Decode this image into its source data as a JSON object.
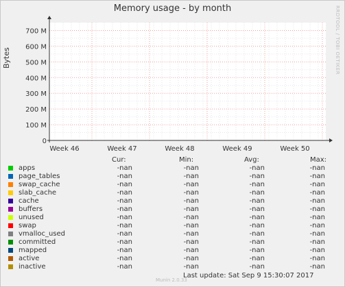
{
  "watermark": "RRDTOOL / TOBI OETIKER",
  "chart_data": {
    "type": "line",
    "title": "Memory usage - by month",
    "ylabel": "Bytes",
    "x_ticks": [
      "Week 46",
      "Week 47",
      "Week 48",
      "Week 49",
      "Week 50"
    ],
    "y_ticks": [
      "0",
      "100 M",
      "200 M",
      "300 M",
      "400 M",
      "500 M",
      "600 M",
      "700 M"
    ],
    "ylim": [
      0,
      750000000
    ],
    "grid": true,
    "series": [
      {
        "name": "apps",
        "color": "#00cc00",
        "cur": "-nan",
        "min": "-nan",
        "avg": "-nan",
        "max": "-nan"
      },
      {
        "name": "page_tables",
        "color": "#0066b3",
        "cur": "-nan",
        "min": "-nan",
        "avg": "-nan",
        "max": "-nan"
      },
      {
        "name": "swap_cache",
        "color": "#ff8000",
        "cur": "-nan",
        "min": "-nan",
        "avg": "-nan",
        "max": "-nan"
      },
      {
        "name": "slab_cache",
        "color": "#ffcc00",
        "cur": "-nan",
        "min": "-nan",
        "avg": "-nan",
        "max": "-nan"
      },
      {
        "name": "cache",
        "color": "#330099",
        "cur": "-nan",
        "min": "-nan",
        "avg": "-nan",
        "max": "-nan"
      },
      {
        "name": "buffers",
        "color": "#990099",
        "cur": "-nan",
        "min": "-nan",
        "avg": "-nan",
        "max": "-nan"
      },
      {
        "name": "unused",
        "color": "#ccff00",
        "cur": "-nan",
        "min": "-nan",
        "avg": "-nan",
        "max": "-nan"
      },
      {
        "name": "swap",
        "color": "#ff0000",
        "cur": "-nan",
        "min": "-nan",
        "avg": "-nan",
        "max": "-nan"
      },
      {
        "name": "vmalloc_used",
        "color": "#808080",
        "cur": "-nan",
        "min": "-nan",
        "avg": "-nan",
        "max": "-nan"
      },
      {
        "name": "committed",
        "color": "#008f00",
        "cur": "-nan",
        "min": "-nan",
        "avg": "-nan",
        "max": "-nan"
      },
      {
        "name": "mapped",
        "color": "#00487d",
        "cur": "-nan",
        "min": "-nan",
        "avg": "-nan",
        "max": "-nan"
      },
      {
        "name": "active",
        "color": "#b35a00",
        "cur": "-nan",
        "min": "-nan",
        "avg": "-nan",
        "max": "-nan"
      },
      {
        "name": "inactive",
        "color": "#b38f00",
        "cur": "-nan",
        "min": "-nan",
        "avg": "-nan",
        "max": "-nan"
      }
    ]
  },
  "legend_headers": {
    "cur": "Cur:",
    "min": "Min:",
    "avg": "Avg:",
    "max": "Max:"
  },
  "footer": {
    "last_update": "Last update: Sat Sep  9 15:30:07 2017",
    "munin": "Munin 2.0.33"
  }
}
